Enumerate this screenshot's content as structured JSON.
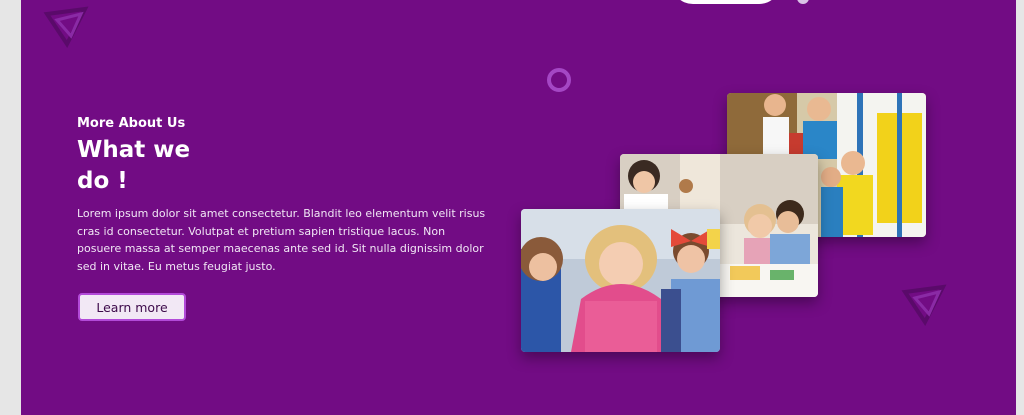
{
  "section": {
    "eyebrow": "More About Us",
    "title": "What we do !",
    "description": "Lorem ipsum dolor sit amet consectetur. Blandit leo elementum velit risus cras id consectetur. Volutpat et pretium sapien tristique lacus. Non posuere massa at semper maecenas ante sed id. Sit nulla dignissim dolor sed in vitae. Eu metus feugiat justo.",
    "button_label": "Learn more"
  },
  "colors": {
    "background": "#720c84",
    "accent": "#b24ad8",
    "button_bg": "#f2e8f5"
  },
  "decorations": {
    "icons": [
      "triangle-outline-icon",
      "circle-outline-icon"
    ]
  },
  "images": [
    {
      "name": "kids-playground-photo"
    },
    {
      "name": "kids-classroom-drawing-photo"
    },
    {
      "name": "kids-smiling-group-photo"
    }
  ]
}
